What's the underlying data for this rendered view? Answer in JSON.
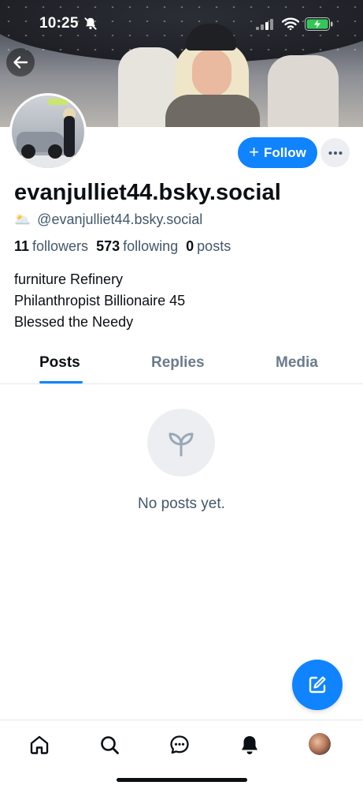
{
  "status_bar": {
    "time": "10:25"
  },
  "profile": {
    "display_name": "evanjulliet44.bsky.social",
    "handle": "@evanjulliet44.bsky.social",
    "handle_emoji": "🌥️",
    "follow_label": "Follow",
    "stats": {
      "followers_count": "11",
      "followers_label": "followers",
      "following_count": "573",
      "following_label": "following",
      "posts_count": "0",
      "posts_label": "posts"
    },
    "bio_lines": [
      "furniture Refinery",
      "Philanthropist Billionaire 45",
      "Blessed the Needy"
    ]
  },
  "tabs": [
    {
      "label": "Posts",
      "active": true
    },
    {
      "label": "Replies",
      "active": false
    },
    {
      "label": "Media",
      "active": false
    }
  ],
  "feed": {
    "empty_text": "No posts yet."
  },
  "icons": {
    "back": "arrow-left-icon",
    "more": "ellipsis-icon",
    "empty": "sprout-icon",
    "compose": "compose-icon",
    "nav": [
      "home-icon",
      "search-icon",
      "chat-icon",
      "bell-icon",
      "profile-avatar"
    ]
  },
  "colors": {
    "accent": "#1083fe",
    "text_primary": "#0b0f14",
    "text_secondary": "#42576c",
    "muted_bg": "#eceef1"
  }
}
